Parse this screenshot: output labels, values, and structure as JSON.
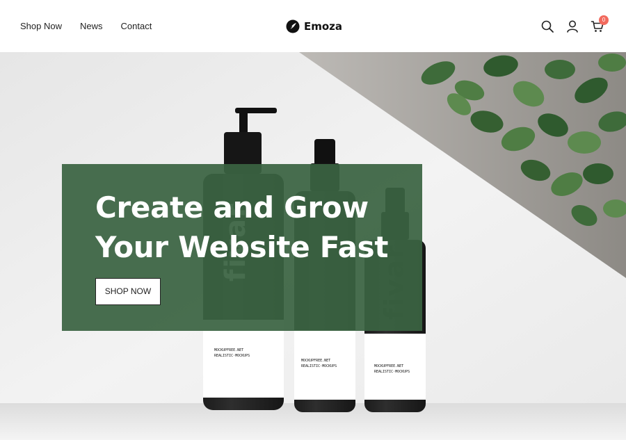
{
  "header": {
    "nav": [
      "Shop Now",
      "News",
      "Contact"
    ],
    "logo_text": "Emoza",
    "cart_count": "0"
  },
  "hero": {
    "headline_line1": "Create and Grow",
    "headline_line2": "Your Website Fast",
    "button_label": "SHOP NOW",
    "bottle_brand": "fivar",
    "bottle_label_1": "MOCKUPFREE.NET",
    "bottle_label_2": "REALISTIC·MOCKUPS"
  },
  "colors": {
    "overlay": "#3a6342",
    "badge": "#f26a5e",
    "leaf_dark": "#2f5a2e",
    "leaf_light": "#5d8a4f"
  },
  "icons": [
    "logo-mark-icon",
    "search-icon",
    "user-icon",
    "cart-icon"
  ]
}
